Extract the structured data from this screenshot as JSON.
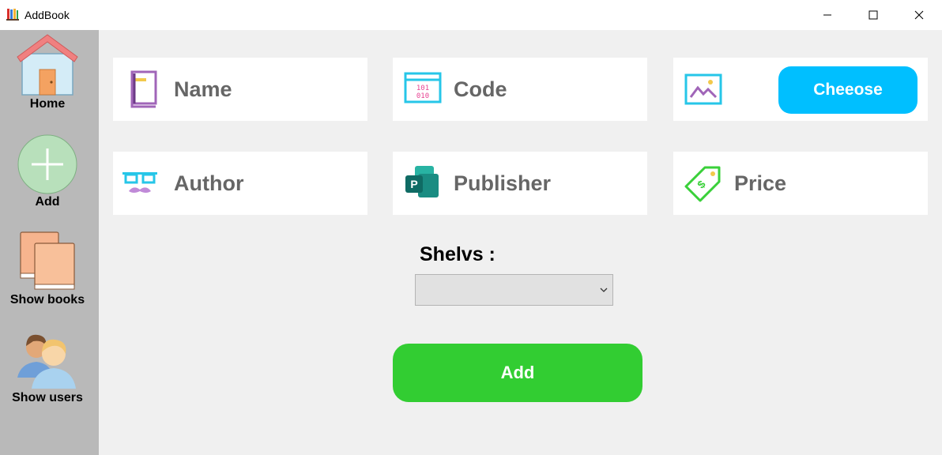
{
  "window": {
    "title": "AddBook",
    "app_icon": "books-icon",
    "controls": [
      "minimize-icon",
      "maximize-icon",
      "close-icon"
    ]
  },
  "sidebar": {
    "background": "#b9b9b9",
    "items": [
      {
        "label": "Home",
        "icon": "house-icon"
      },
      {
        "label": "Add",
        "icon": "plus-circle-icon"
      },
      {
        "label": "Show books",
        "icon": "books-stack-icon"
      },
      {
        "label": "Show users",
        "icon": "users-icon"
      }
    ]
  },
  "form": {
    "fields": [
      {
        "label": "Name",
        "icon": "book-icon"
      },
      {
        "label": "Code",
        "icon": "binary-code-icon"
      },
      {
        "label": "",
        "icon": "image-icon"
      },
      {
        "label": "Author",
        "icon": "glasses-mustache-icon"
      },
      {
        "label": "Publisher",
        "icon": "publisher-app-icon"
      },
      {
        "label": "Price",
        "icon": "price-tag-icon"
      }
    ],
    "choose_button": "Cheeose",
    "shelves": {
      "label": "Shelvs :",
      "selected": ""
    },
    "add_button": "Add"
  },
  "colors": {
    "choose_button": "#00bfff",
    "add_button": "#32cd32",
    "field_label": "#666666",
    "background": "#f0f0f0"
  }
}
